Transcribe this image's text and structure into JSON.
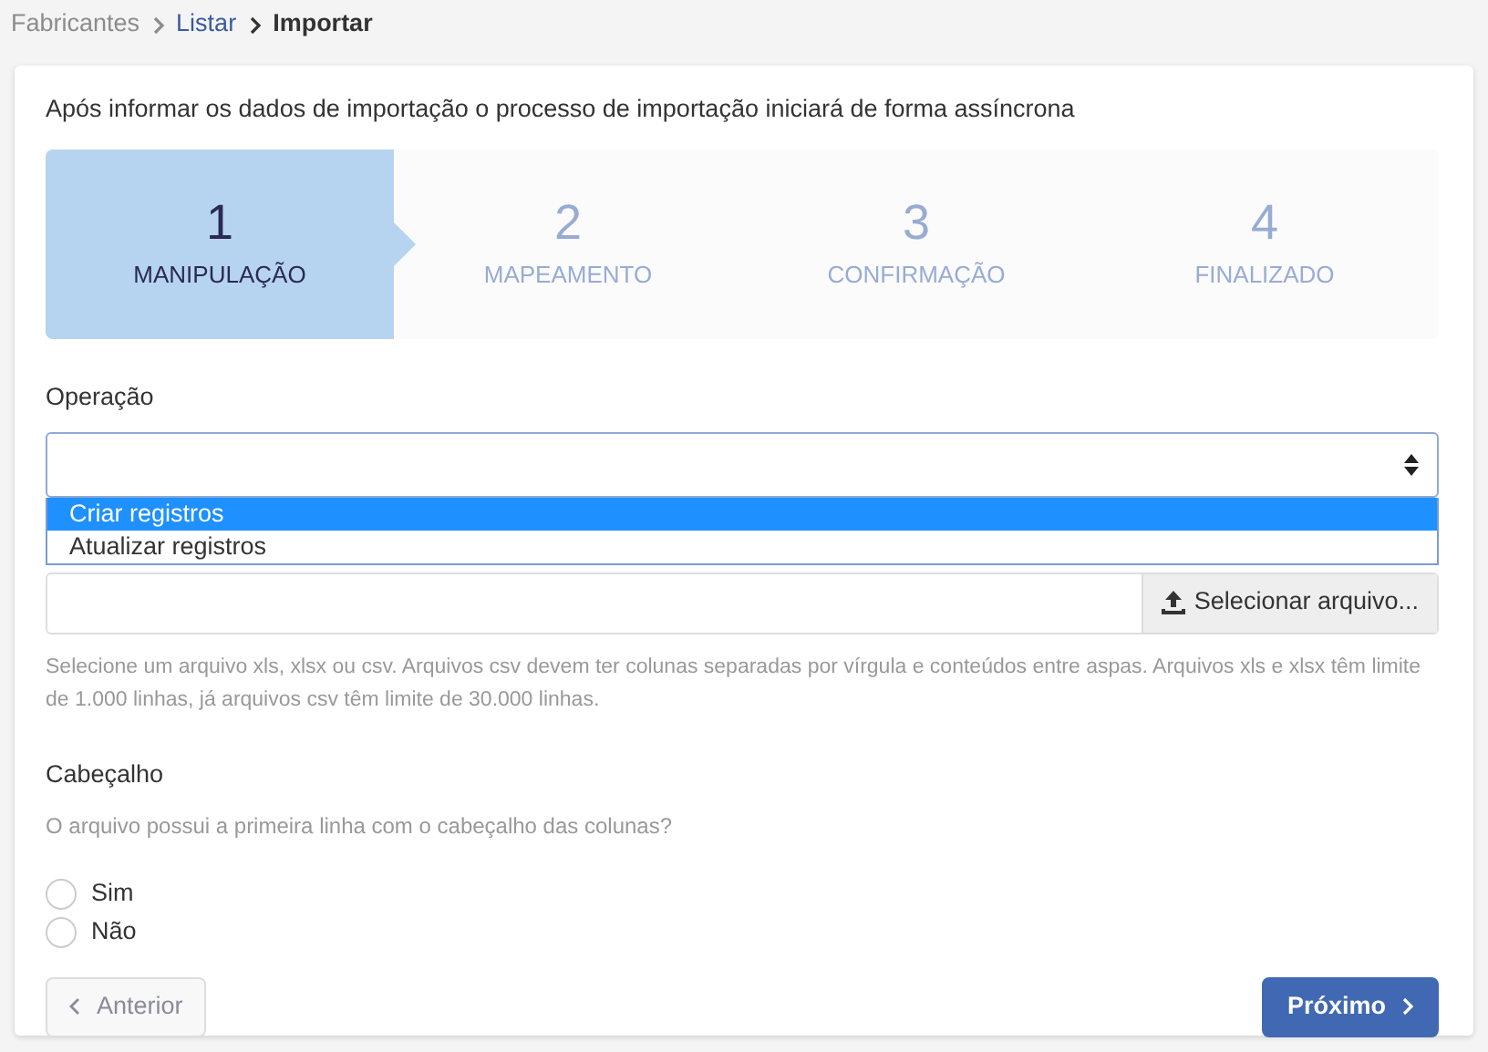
{
  "breadcrumb": [
    {
      "label": "Fabricantes",
      "kind": "muted"
    },
    {
      "label": "Listar",
      "kind": "link"
    },
    {
      "label": "Importar",
      "kind": "current"
    }
  ],
  "intro": "Após informar os dados de importação o processo de importação iniciará de forma assíncrona",
  "steps": [
    {
      "number": "1",
      "label": "MANIPULAÇÃO",
      "selected": true
    },
    {
      "number": "2",
      "label": "MAPEAMENTO",
      "selected": false
    },
    {
      "number": "3",
      "label": "CONFIRMAÇÃO",
      "selected": false
    },
    {
      "number": "4",
      "label": "FINALIZADO",
      "selected": false
    }
  ],
  "operation": {
    "label": "Operação",
    "expanded": true,
    "options": [
      {
        "label": "Criar registros",
        "selected": true
      },
      {
        "label": "Atualizar registros",
        "selected": false
      }
    ]
  },
  "file": {
    "button": "Selecionar arquivo...",
    "help": "Selecione um arquivo xls, xlsx ou csv. Arquivos csv devem ter colunas separadas por vírgula e conteúdos entre aspas. Arquivos xls e xlsx têm limite de 1.000 linhas, já arquivos csv têm limite de 30.000 linhas."
  },
  "header": {
    "label": "Cabeçalho",
    "question": "O arquivo possui a primeira linha com o cabeçalho das colunas?",
    "options": [
      {
        "label": "Sim",
        "checked": false
      },
      {
        "label": "Não",
        "checked": false
      }
    ]
  },
  "buttons": {
    "previous": {
      "label": "Anterior",
      "disabled": true
    },
    "next": {
      "label": "Próximo",
      "disabled": false
    }
  }
}
